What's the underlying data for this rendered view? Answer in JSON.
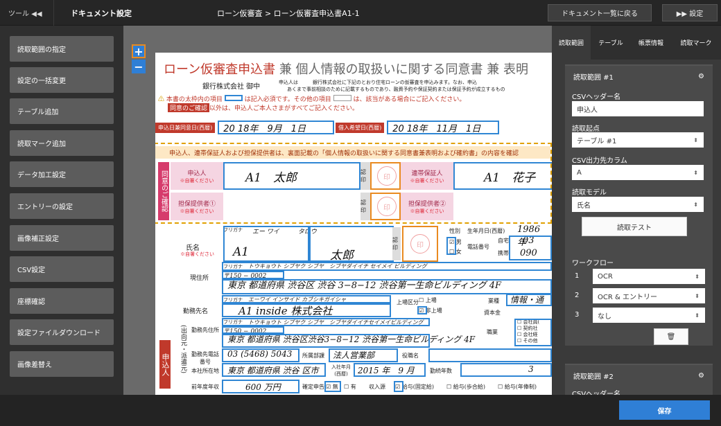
{
  "topbar": {
    "tool_label": "ツール ◀◀",
    "doc_settings": "ドキュメント設定",
    "breadcrumb": "ローン仮審査 > ローン仮審査申込書A1-1",
    "back_button": "ドキュメント一覧に戻る",
    "settings_button": "▶▶ 設定"
  },
  "nav": [
    "読取範囲の指定",
    "設定の一括変更",
    "テーブル追加",
    "読取マーク追加",
    "データ加工設定",
    "エントリーの設定",
    "画像補正設定",
    "CSV設定",
    "座標確認",
    "設定ファイルダウンロード",
    "画像差替え"
  ],
  "zoom": {
    "plus": "+",
    "minus": "−"
  },
  "doc": {
    "title_red": "ローン仮審査申込書",
    "title_gray": " 兼 個人情報の取扱いに関する同意書 兼 表明",
    "bank": "銀行株式会社 御中",
    "intro1": "申込人は　　　銀行株式会社に下記のとおり住宅ローンの仮審査を申込みます。なお、申込",
    "intro2": "あくまで事前相談のために記載するものであり、融資予約や保証契約または保証予約が成立するもの",
    "warn1": "本書の太枠内の項目",
    "warn1b": "は記入必須です。その他の項目",
    "warn1c": "は、該当がある場合にご記入ください。",
    "warn2_pill": "同意のご確認",
    "warn2": "以外は、申込人ご本人さまがすべてご記入ください。",
    "date1_label": "申込日兼同意日(西暦)",
    "date1_val": "20 18年　9月　1日",
    "date2_label": "借入希望日(西暦)",
    "date2_val": "20 18年　11月　1日",
    "consent_head": "申込人、連帯保証人および担保提供者は、裏面記載の「個人情報の取扱いに関する同意書兼表明および確約書」の内容を確認",
    "consent_side": "同意のご確認",
    "applicant": "申込人",
    "write_req": "※自署ください",
    "applicant_name": "A1　太郎",
    "guarantor": "連帯保証人",
    "guarantor_name": "A1　花子",
    "collateral1": "担保提供者①",
    "collateral2": "担保提供者②",
    "seal": "認印",
    "stamp": "印",
    "furigana": "フリガナ",
    "furi_val": "エー ワイ　　　タロウ",
    "name_label": "氏名",
    "name_sei": "A1",
    "name_mei": "太郎",
    "gender_label": "性別",
    "male": "男",
    "female": "女",
    "birth_label": "生年月日(西暦)",
    "birth_val": "1986 年",
    "phone_label": "電話番号",
    "home": "自宅",
    "home_val": "03",
    "mobile": "携帯",
    "mobile_val": "090",
    "address_label": "現住所",
    "address_furi": "トウキョウト シブヤク シブヤ　シブヤダイイチ セイメイ ビルディング",
    "zip": "〒150 − 0002",
    "address_val": "東京 都道府県 渋谷区 渋谷 3−8−12 渋谷第一生命ビルディング 4F",
    "work_label": "勤務先名",
    "work_furi": "エーワイ インサイド カブシキガイシャ",
    "work_val": "A1 inside 株式会社",
    "listed": "上場",
    "unlisted": "非上場",
    "listing_label": "上場区分",
    "industry": "業種",
    "industry_val": "情報・通",
    "capital": "資本金",
    "work_addr_label": "勤務先住所",
    "work_addr_furi": "トウキョウト シブヤク シブヤ　シブヤダイイチセイメイビルディング",
    "work_zip": "〒150 − 0002",
    "work_addr_val": "東京 都道府県 渋谷区渋谷3−8−12 渋谷第一生命ビルディング 4F",
    "job": "職業",
    "job_opts": [
      "会社員(",
      "契約社",
      "会社経",
      "その他"
    ],
    "side_col": "申込人",
    "side_col2": "(出向元・派遣元)",
    "work_phone_label": "勤務先電話番号",
    "work_phone": "03 (5468) 5043",
    "dept_label": "所属部課",
    "dept_val": "法人営業部",
    "pos_label": "役職名",
    "hq_label": "本社所在地",
    "hq_val": "東京 都道府県 渋谷 区市",
    "join_label": "入社年月(西暦)",
    "join_val": "2015 年　9 月",
    "years_label": "勤続年数",
    "years_val": "3",
    "income_label": "前年度年収",
    "income_val": "600 万円",
    "tax_label": "確定申告",
    "tax_none": "無",
    "tax_yes": "有",
    "source_label": "収入源",
    "source1": "給与(固定給)",
    "source2": "給与(歩合給)",
    "source3": "給与(年俸制)"
  },
  "panel": {
    "tabs": [
      "読取範囲",
      "テーブル",
      "帳票情報",
      "読取マーク"
    ],
    "range1_title": "読取範囲 #1",
    "csv_header_label": "CSVヘッダー名",
    "csv_header_value": "申込人",
    "origin_label": "読取起点",
    "origin_value": "テーブル #1",
    "csv_col_label": "CSV出力先カラム",
    "csv_col_value": "A",
    "model_label": "読取モデル",
    "model_value": "氏名",
    "test_button": "読取テスト",
    "workflow_label": "ワークフロー",
    "workflow": [
      {
        "num": "1",
        "value": "OCR"
      },
      {
        "num": "2",
        "value": "OCR & エントリー"
      },
      {
        "num": "3",
        "value": "なし"
      }
    ],
    "trash_icon": "🗑",
    "gear_icon": "⚙",
    "range2_title": "読取範囲 #2",
    "range2_csv_label": "CSVヘッダー名"
  },
  "save_button": "保存",
  "colors": {
    "accent": "#2f7fd6",
    "doc_red": "#c0392b",
    "box_blue": "#2f86d4",
    "box_orange": "#e98a20"
  }
}
